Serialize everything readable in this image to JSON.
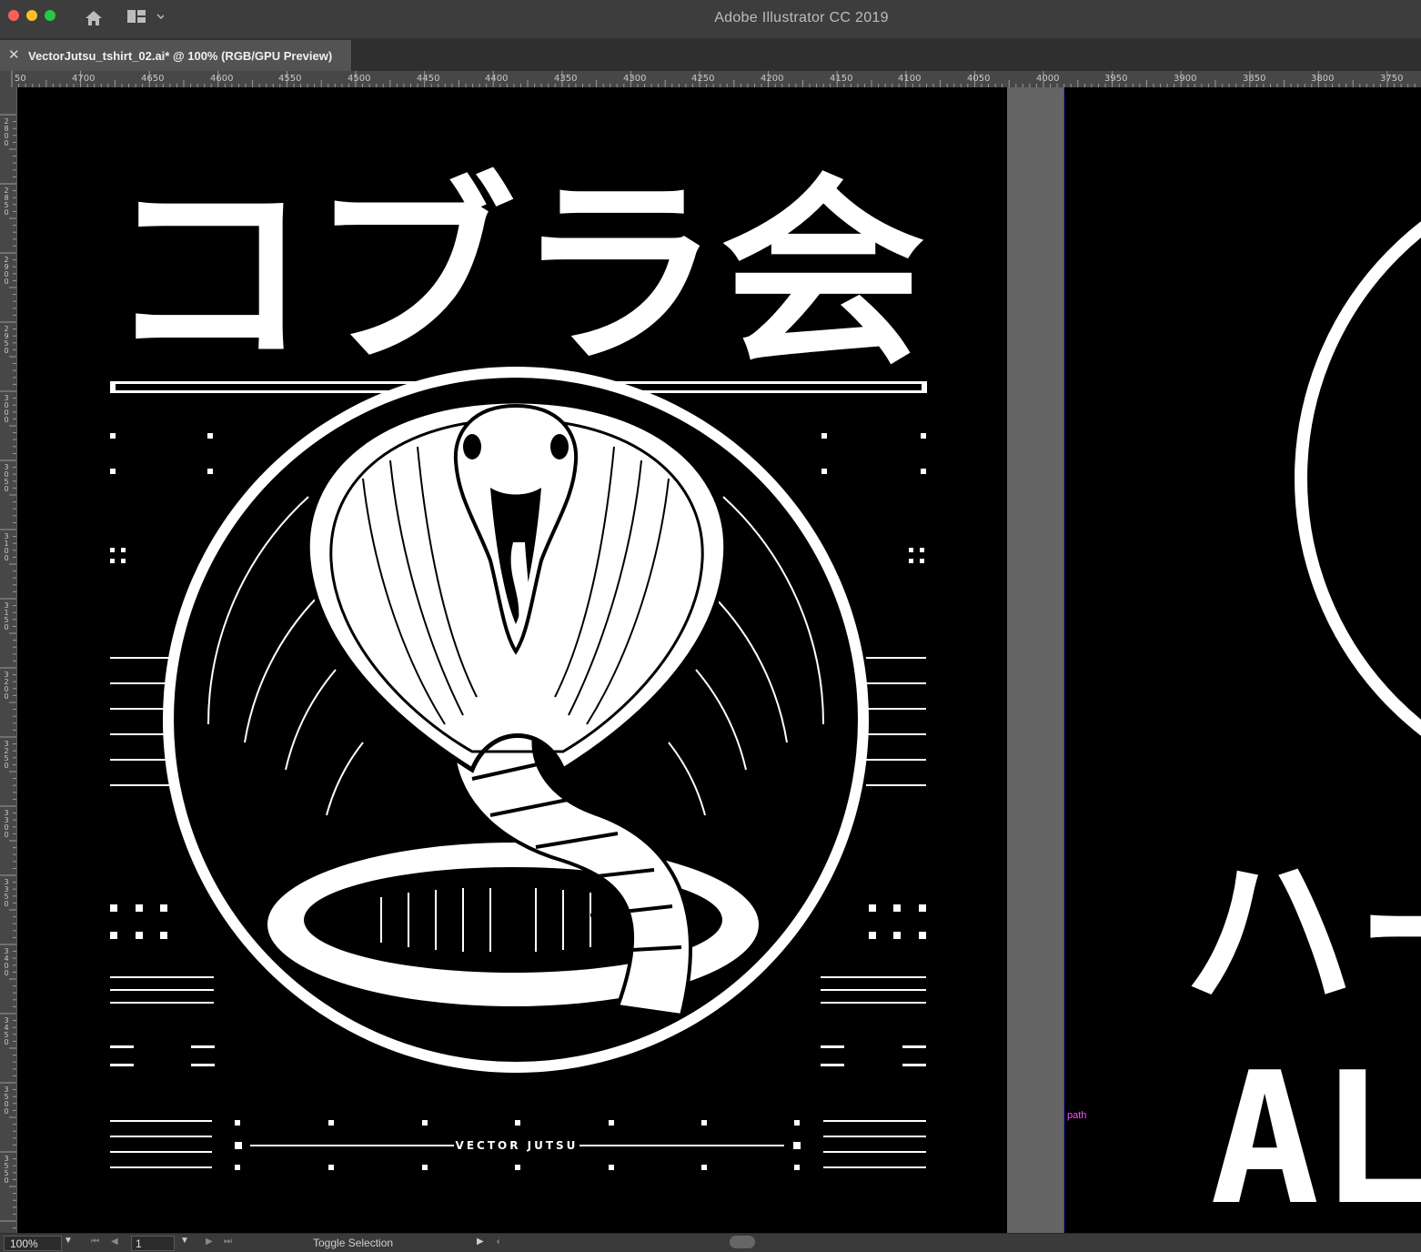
{
  "app": {
    "title": "Adobe Illustrator CC 2019"
  },
  "tab": {
    "close_glyph": "✕",
    "title": "VectorJutsu_tshirt_02.ai* @ 100% (RGB/GPU Preview)"
  },
  "icons": {
    "home": "home-icon",
    "workspace": "workspace-switcher-icon"
  },
  "rulers": {
    "horizontal": [
      "50",
      "4700",
      "4650",
      "4600",
      "4550",
      "4500",
      "4450",
      "4400",
      "4350",
      "4300",
      "4250",
      "4200",
      "4150",
      "4100",
      "4050",
      "4000",
      "3950",
      "3900",
      "3850",
      "3800",
      "3750"
    ],
    "vertical": [
      "2800",
      "2850",
      "2900",
      "2950",
      "3000",
      "3050",
      "3100",
      "3150",
      "3200",
      "3250",
      "3300",
      "3350",
      "3400",
      "3450",
      "3500",
      "3550"
    ]
  },
  "artboard1": {
    "title_jp": "コブラ会",
    "brand": "VECTOR JUTSU"
  },
  "artboard2": {
    "title_jp": "ハー",
    "title_en": "AL"
  },
  "smart_guide": {
    "label": "path"
  },
  "status": {
    "zoom": "100%",
    "page": "1",
    "action": "Toggle Selection"
  },
  "colors": {
    "artboard": "#000000",
    "art": "#ffffff",
    "smart_guide": "#ff4dff",
    "ui_dark": "#3d3d3d"
  }
}
